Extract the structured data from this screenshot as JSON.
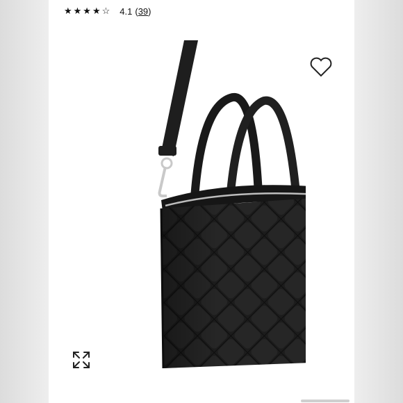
{
  "rating": {
    "stars": "★★★★☆",
    "value": "4.1",
    "count": "39",
    "count_open": "(",
    "count_close": ")"
  },
  "icons": {
    "wishlist": "heart-outline-icon",
    "expand": "expand-arrows-icon"
  },
  "colors": {
    "bag": "#1b1b1b",
    "hardware": "#c9c9c9",
    "background": "#ffffff"
  }
}
